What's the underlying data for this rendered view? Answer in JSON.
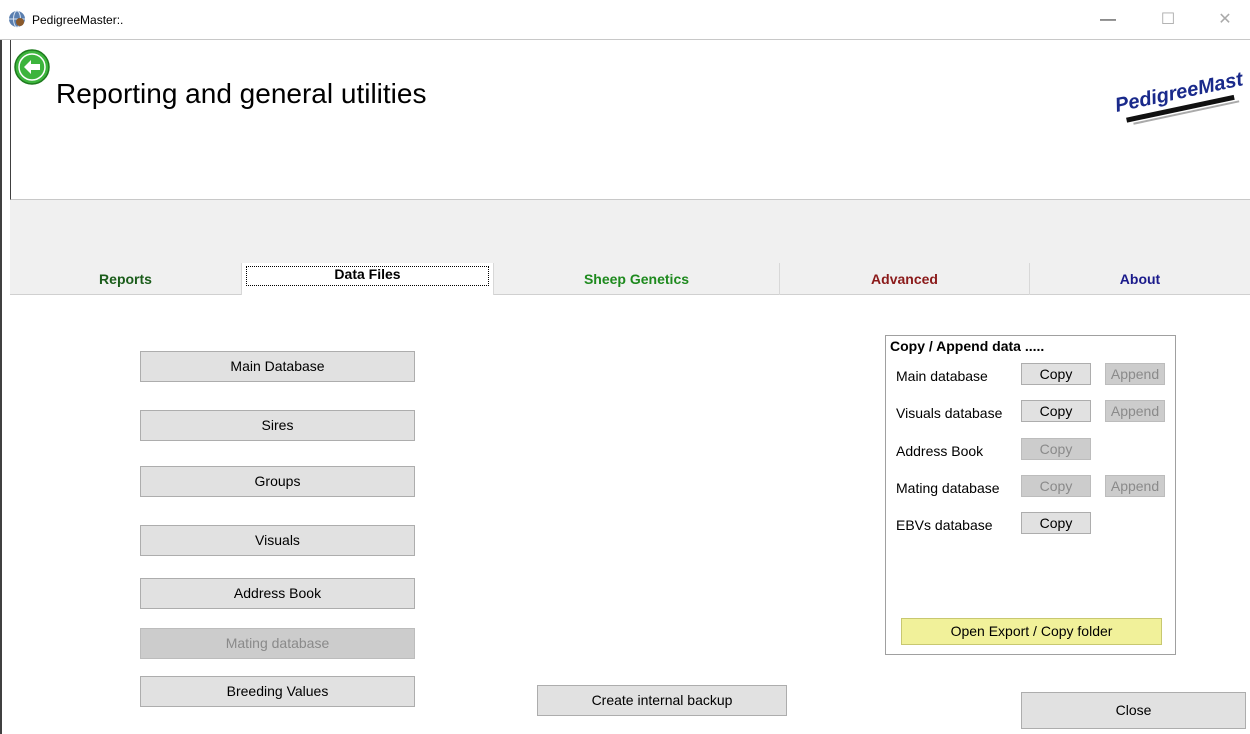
{
  "window": {
    "title": "PedigreeMaster:.",
    "minimize": "—",
    "maximize": "☐",
    "close": "✕"
  },
  "header": {
    "title": "Reporting and general utilities",
    "logo_text": "PedigreeMaster",
    "back_icon": "left-arrow-icon"
  },
  "tabs": [
    {
      "label": "Reports",
      "color": "#1a5c1a"
    },
    {
      "label": "Data Files",
      "color": "#000000"
    },
    {
      "label": "Sheep Genetics",
      "color": "#1e8a1e"
    },
    {
      "label": "Advanced",
      "color": "#8b1a1a"
    },
    {
      "label": "About",
      "color": "#1a1a8b"
    }
  ],
  "main_buttons": [
    {
      "label": "Main Database",
      "enabled": true
    },
    {
      "label": "Sires",
      "enabled": true
    },
    {
      "label": "Groups",
      "enabled": true
    },
    {
      "label": "Visuals",
      "enabled": true
    },
    {
      "label": "Address Book",
      "enabled": true
    },
    {
      "label": "Mating database",
      "enabled": false
    },
    {
      "label": "Breeding Values",
      "enabled": true
    }
  ],
  "copy_panel": {
    "title": "Copy / Append data .....",
    "rows": [
      {
        "label": "Main database",
        "copy": "Copy",
        "copy_enabled": true,
        "append": "Append",
        "append_enabled": false
      },
      {
        "label": "Visuals database",
        "copy": "Copy",
        "copy_enabled": true,
        "append": "Append",
        "append_enabled": false
      },
      {
        "label": "Address Book",
        "copy": "Copy",
        "copy_enabled": false
      },
      {
        "label": "Mating database",
        "copy": "Copy",
        "copy_enabled": false,
        "append": "Append",
        "append_enabled": false
      },
      {
        "label": "EBVs database",
        "copy": "Copy",
        "copy_enabled": true
      }
    ],
    "open_folder": "Open Export / Copy folder",
    "open_folder_color": "#f1f19a"
  },
  "footer": {
    "backup": "Create internal backup",
    "close": "Close"
  }
}
